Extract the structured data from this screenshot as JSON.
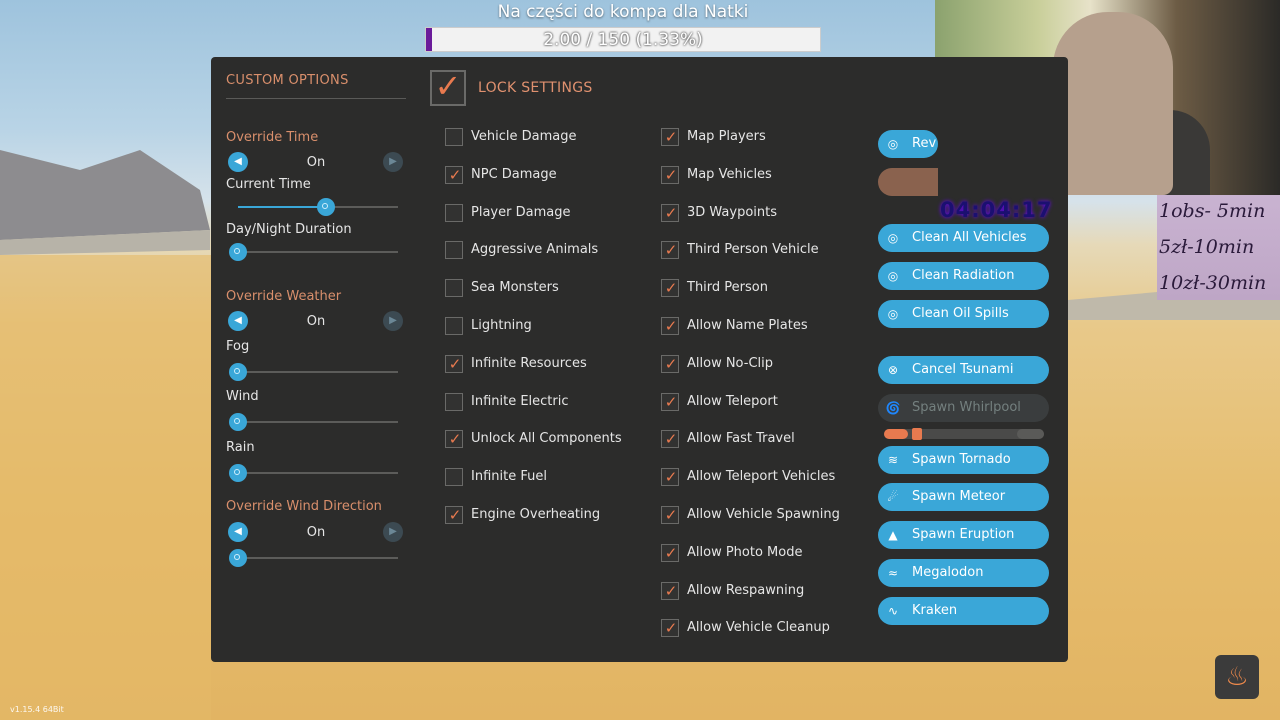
{
  "donation": {
    "title": "Na części do kompa dla Natki",
    "progress_text": "2.00 / 150 (1.33%)",
    "progress_fraction": 0.0133,
    "fill_color": "#6a1b9a"
  },
  "custom_options": {
    "heading": "CUSTOM OPTIONS",
    "override_time": {
      "label": "Override Time",
      "value": "On"
    },
    "current_time": {
      "label": "Current Time",
      "slider_value": 0.55
    },
    "day_night": {
      "label": "Day/Night Duration",
      "slider_value": 0.0
    },
    "override_weather": {
      "label": "Override Weather",
      "value": "On"
    },
    "fog": {
      "label": "Fog",
      "slider_value": 0.0
    },
    "wind": {
      "label": "Wind",
      "slider_value": 0.0
    },
    "rain": {
      "label": "Rain",
      "slider_value": 0.0
    },
    "override_wind_dir": {
      "label": "Override Wind Direction",
      "value": "On",
      "slider_value": 0.0
    }
  },
  "lock": {
    "label": "LOCK SETTINGS",
    "checked": true
  },
  "left_options": [
    {
      "label": "Vehicle Damage",
      "checked": false
    },
    {
      "label": "NPC Damage",
      "checked": true
    },
    {
      "label": "Player Damage",
      "checked": false
    },
    {
      "label": "Aggressive Animals",
      "checked": false
    },
    {
      "label": "Sea Monsters",
      "checked": false
    },
    {
      "label": "Lightning",
      "checked": false
    },
    {
      "label": "Infinite Resources",
      "checked": true
    },
    {
      "label": "Infinite Electric",
      "checked": false
    },
    {
      "label": "Unlock All Components",
      "checked": true
    },
    {
      "label": "Infinite Fuel",
      "checked": false
    },
    {
      "label": "Engine Overheating",
      "checked": true
    }
  ],
  "right_options": [
    {
      "label": "Map Players",
      "checked": true
    },
    {
      "label": "Map Vehicles",
      "checked": true
    },
    {
      "label": "3D Waypoints",
      "checked": true
    },
    {
      "label": "Third Person Vehicle",
      "checked": true
    },
    {
      "label": "Third Person",
      "checked": true
    },
    {
      "label": "Allow Name Plates",
      "checked": true
    },
    {
      "label": "Allow No-Clip",
      "checked": true
    },
    {
      "label": "Allow Teleport",
      "checked": true
    },
    {
      "label": "Allow Fast Travel",
      "checked": true
    },
    {
      "label": "Allow Teleport Vehicles",
      "checked": true
    },
    {
      "label": "Allow Vehicle Spawning",
      "checked": true
    },
    {
      "label": "Allow Photo Mode",
      "checked": true
    },
    {
      "label": "Allow Respawning",
      "checked": true
    },
    {
      "label": "Allow Vehicle Cleanup",
      "checked": true
    }
  ],
  "actions": {
    "rev_partial": "Rev",
    "clean_all_vehicles": "Clean All Vehicles",
    "clean_radiation": "Clean Radiation",
    "clean_oil_spills": "Clean Oil Spills",
    "cancel_tsunami": "Cancel Tsunami",
    "spawn_whirlpool": "Spawn Whirlpool",
    "whirlpool_slider_value": 0.2,
    "spawn_tornado": "Spawn Tornado",
    "spawn_meteor": "Spawn Meteor",
    "spawn_eruption": "Spawn Eruption",
    "megalodon": "Megalodon",
    "kraken": "Kraken"
  },
  "overlay": {
    "timer": "04:04:17",
    "price_lines": [
      "1obs- 5min",
      "5zł-10min",
      "10zł-30min"
    ]
  },
  "version": "v1.15.4 64Bit",
  "colors": {
    "accent_blue": "#3aa7d8",
    "accent_orange": "#e87a4f",
    "panel": "#2c2c2b"
  },
  "icons": {
    "prev_arrow": "arrow-left-icon",
    "next_arrow": "arrow-right-icon",
    "target": "target-icon",
    "cancel": "x-circle-icon",
    "whirlpool": "swirl-icon",
    "tornado": "tornado-icon",
    "meteor": "meteor-icon",
    "eruption": "volcano-icon",
    "shark": "shark-icon",
    "kraken": "tentacle-icon",
    "heat": "heat-icon"
  }
}
